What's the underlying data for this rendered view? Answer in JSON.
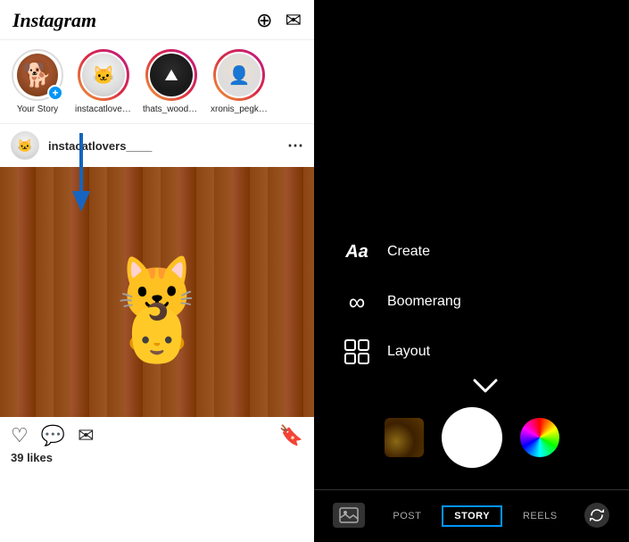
{
  "app": {
    "name": "Instagram"
  },
  "header": {
    "logo": "Instagram",
    "new_post_icon": "⊕",
    "messenger_icon": "✈"
  },
  "stories": [
    {
      "id": "your_story",
      "label": "Your Story",
      "is_own": true,
      "avatar": "🐕"
    },
    {
      "id": "instacatlovers",
      "label": "instacatlovers...",
      "is_own": false,
      "avatar": "🐱"
    },
    {
      "id": "thats_wood",
      "label": "thats_wood_...",
      "is_own": false,
      "avatar": "⛰"
    },
    {
      "id": "xronis_pegk",
      "label": "xronis_pegk_...",
      "is_own": false,
      "avatar": "👤"
    }
  ],
  "post": {
    "username": "instacatlovers____",
    "avatar": "🐱",
    "likes": "39 likes",
    "more_icon": "⋯"
  },
  "actions": {
    "like_icon": "♡",
    "comment_icon": "💬",
    "share_icon": "✈",
    "bookmark_icon": "🔖"
  },
  "camera": {
    "options": [
      {
        "id": "create",
        "icon": "Aa",
        "label": "Create"
      },
      {
        "id": "boomerang",
        "icon": "∞",
        "label": "Boomerang"
      },
      {
        "id": "layout",
        "icon": "⊞",
        "label": "Layout"
      }
    ],
    "chevron": "∨"
  },
  "bottom_nav": [
    {
      "id": "gallery",
      "label": "",
      "icon": "gallery",
      "active": false
    },
    {
      "id": "post",
      "label": "POST",
      "active": false
    },
    {
      "id": "story",
      "label": "STORY",
      "active": true
    },
    {
      "id": "reels",
      "label": "REELS",
      "active": false
    },
    {
      "id": "flip",
      "label": "",
      "icon": "flip",
      "active": false
    }
  ]
}
